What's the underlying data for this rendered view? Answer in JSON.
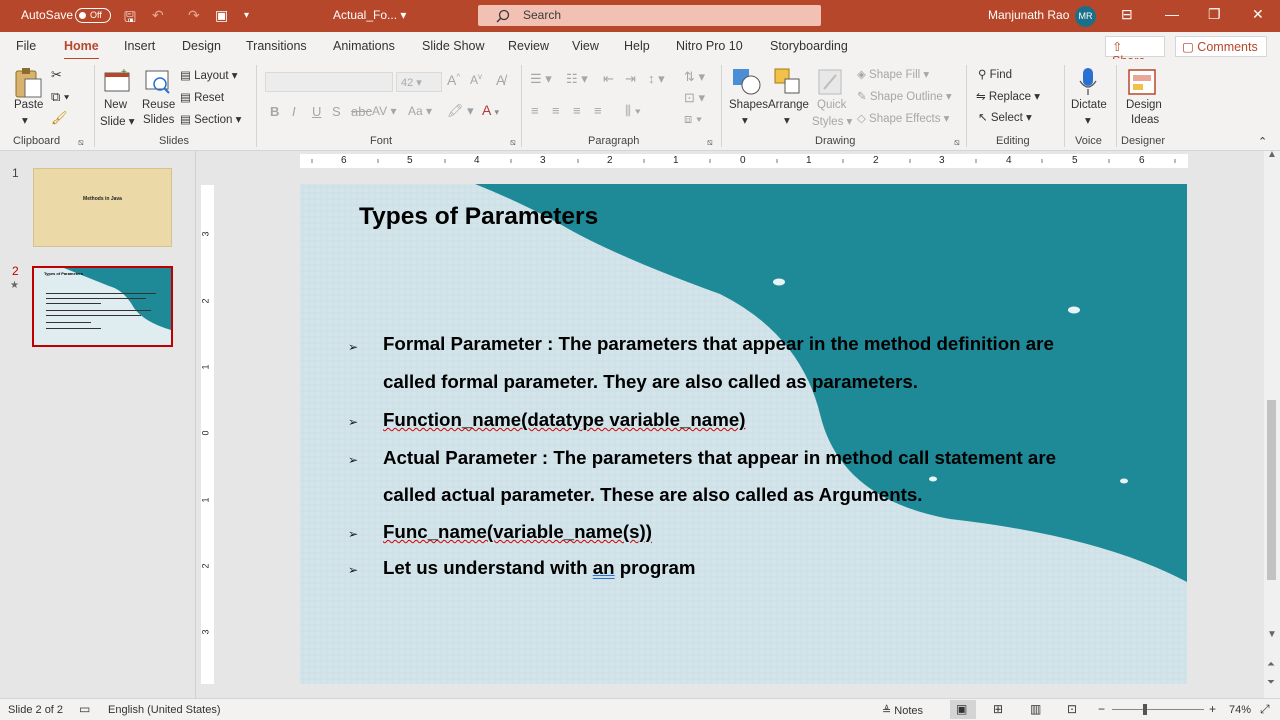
{
  "titlebar": {
    "autosave_label": "AutoSave",
    "autosave_state": "Off",
    "file_name": "Actual_Fo...",
    "search_placeholder": "Search",
    "user_name": "Manjunath Rao",
    "user_initials": "MR"
  },
  "menu": {
    "tabs": [
      "File",
      "Home",
      "Insert",
      "Design",
      "Transitions",
      "Animations",
      "Slide Show",
      "Review",
      "View",
      "Help",
      "Nitro Pro 10",
      "Storyboarding"
    ],
    "active_tab": "Home",
    "share_label": "Share",
    "comments_label": "Comments"
  },
  "ribbon": {
    "clipboard": {
      "paste": "Paste",
      "group": "Clipboard"
    },
    "slides": {
      "new_slide_1": "New",
      "new_slide_2": "Slide",
      "reuse_1": "Reuse",
      "reuse_2": "Slides",
      "layout": "Layout",
      "reset": "Reset",
      "section": "Section",
      "group": "Slides"
    },
    "font": {
      "size": "42",
      "group": "Font"
    },
    "paragraph": {
      "group": "Paragraph"
    },
    "drawing": {
      "shapes": "Shapes",
      "arrange": "Arrange",
      "quick_1": "Quick",
      "quick_2": "Styles",
      "shape_fill": "Shape Fill",
      "shape_outline": "Shape Outline",
      "shape_effects": "Shape Effects",
      "group": "Drawing"
    },
    "editing": {
      "find": "Find",
      "replace": "Replace",
      "select": "Select",
      "group": "Editing"
    },
    "voice": {
      "dictate": "Dictate",
      "group": "Voice"
    },
    "designer": {
      "ideas_1": "Design",
      "ideas_2": "Ideas",
      "group": "Designer"
    }
  },
  "thumbnails": [
    {
      "number": "1",
      "title": "Methods in Java"
    },
    {
      "number": "2",
      "title": "Types of Parameters"
    }
  ],
  "ruler": {
    "h_ticks": [
      "6",
      "5",
      "4",
      "3",
      "2",
      "1",
      "0",
      "1",
      "2",
      "3",
      "4",
      "5",
      "6"
    ],
    "v_ticks": [
      "3",
      "2",
      "1",
      "0",
      "1",
      "2",
      "3"
    ]
  },
  "slide": {
    "title": "Types of Parameters",
    "bullets": [
      {
        "line1": " Formal Parameter : The parameters that appear in the method definition are",
        "line2": "called formal parameter. They are also called as parameters."
      },
      {
        "line1": "Function_name(datatype variable_name)"
      },
      {
        "line1": "Actual Parameter : The parameters that appear in method call statement are",
        "line2": "called actual parameter. These are also called as Arguments."
      },
      {
        "line1": "Func_name(variable_name(s))"
      },
      {
        "pre": "Let us understand with ",
        "mid": "an",
        "post": " program"
      }
    ],
    "bullet_glyph": "➢",
    "theme_color": "#1e8a98"
  },
  "status": {
    "slide_counter": "Slide 2 of 2",
    "language": "English (United States)",
    "notes": "Notes",
    "zoom": "74%"
  }
}
